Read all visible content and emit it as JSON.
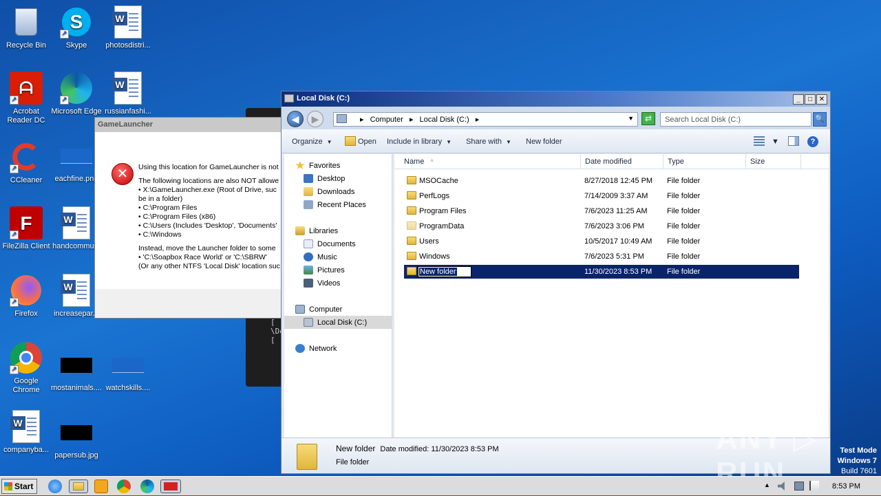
{
  "desktop": {
    "icons": [
      {
        "label": "Recycle Bin"
      },
      {
        "label": "Skype"
      },
      {
        "label": "photosdistri..."
      },
      {
        "label": "Acrobat Reader DC"
      },
      {
        "label": "Microsoft Edge"
      },
      {
        "label": "russianfashi..."
      },
      {
        "label": "CCleaner"
      },
      {
        "label": "eachfine.png"
      },
      {
        "label": "FileZilla Client"
      },
      {
        "label": "handcommu..."
      },
      {
        "label": "Firefox"
      },
      {
        "label": "increasepar..."
      },
      {
        "label": "Google Chrome"
      },
      {
        "label": "mostanimals...."
      },
      {
        "label": "watchskills...."
      },
      {
        "label": "companyba..."
      },
      {
        "label": "papersub.jpg"
      }
    ],
    "shortcut_glyph": "↗"
  },
  "console": {
    "text": "[\n\\De\n["
  },
  "gamelauncher": {
    "title": "GameLauncher",
    "error_glyph": "✕",
    "line1": "Using this location for GameLauncher is not",
    "line2": "The following locations are also NOT allowe",
    "line3": "• X:\\GameLauncher.exe (Root of Drive, suc",
    "line4": "be in a folder)",
    "line5": "• C:\\Program Files",
    "line6": "• C:\\Program Files (x86)",
    "line7": "• C:\\Users (Includes 'Desktop', 'Documents'",
    "line8": "• C:\\Windows",
    "line9": "Instead, move the Launcher folder to some",
    "line10": "• 'C:\\Soapbox Race World' or 'C:\\SBRW'",
    "line11": "(Or any other NTFS 'Local Disk' location suc"
  },
  "explorer": {
    "title": "Local Disk (C:)",
    "min_glyph": "_",
    "max_glyph": "□",
    "close_glyph": "✕",
    "back_glyph": "◀",
    "fwd_glyph": "▶",
    "address": {
      "crumb1": "Computer",
      "crumb2": "Local Disk (C:)",
      "arrow": "▸",
      "drop": "▼"
    },
    "refresh_glyph": "⇄",
    "search": {
      "placeholder": "Search Local Disk (C:)",
      "go_glyph": "🔍"
    },
    "toolbar": {
      "organize": "Organize",
      "open": "Open",
      "include_library": "Include in library",
      "share_with": "Share with",
      "new_folder": "New folder",
      "arrow": "▼",
      "help_glyph": "?"
    },
    "nav": {
      "favorites": "Favorites",
      "desktop": "Desktop",
      "downloads": "Downloads",
      "recent": "Recent Places",
      "libraries": "Libraries",
      "documents": "Documents",
      "music": "Music",
      "pictures": "Pictures",
      "videos": "Videos",
      "computer": "Computer",
      "local_disk": "Local Disk (C:)",
      "network": "Network"
    },
    "columns": {
      "name": "Name",
      "date": "Date modified",
      "type": "Type",
      "size": "Size",
      "sort_glyph": "^"
    },
    "rows": [
      {
        "name": "MSOCache",
        "date": "8/27/2018 12:45 PM",
        "type": "File folder"
      },
      {
        "name": "PerfLogs",
        "date": "7/14/2009 3:37 AM",
        "type": "File folder"
      },
      {
        "name": "Program Files",
        "date": "7/6/2023 11:25 AM",
        "type": "File folder"
      },
      {
        "name": "ProgramData",
        "date": "7/6/2023 3:06 PM",
        "type": "File folder"
      },
      {
        "name": "Users",
        "date": "10/5/2017 10:49 AM",
        "type": "File folder"
      },
      {
        "name": "Windows",
        "date": "7/6/2023 5:31 PM",
        "type": "File folder"
      },
      {
        "name": "New folder",
        "date": "11/30/2023 8:53 PM",
        "type": "File folder"
      }
    ],
    "details": {
      "name": "New folder",
      "date_label": "Date modified:",
      "date_value": "11/30/2023 8:53 PM",
      "type": "File folder"
    }
  },
  "watermark": "ANY ▷ RUN",
  "testmode": {
    "line1": "Test Mode",
    "line2": "Windows 7",
    "line3": "Build 7601"
  },
  "taskbar": {
    "start": "Start",
    "clock": "8:53 PM",
    "tray_up": "▲"
  },
  "colors": {
    "selection": "#0a246a",
    "title_bar": "#0b2d7c",
    "error": "#c40000"
  }
}
